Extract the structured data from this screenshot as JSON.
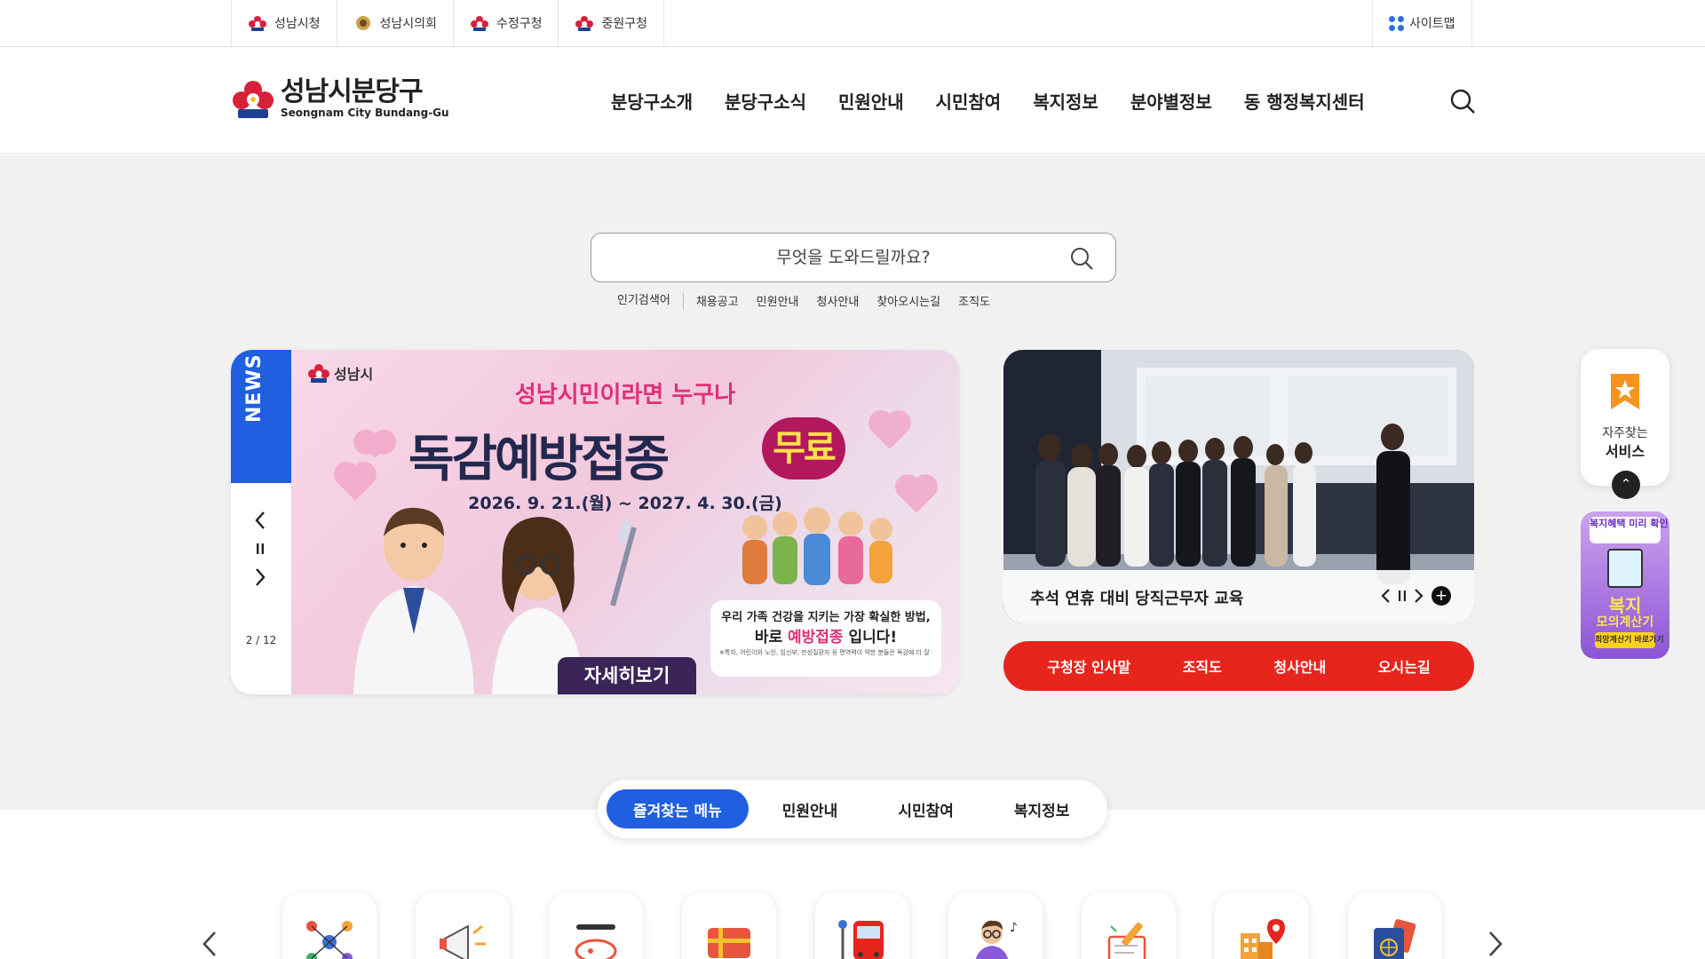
{
  "top_links": [
    {
      "label": "성남시청",
      "icon": "seongnam-emblem-icon"
    },
    {
      "label": "성남시의회",
      "icon": "council-emblem-icon"
    },
    {
      "label": "수정구청",
      "icon": "seongnam-emblem-icon"
    },
    {
      "label": "중원구청",
      "icon": "seongnam-emblem-icon"
    }
  ],
  "sitemap_label": "사이트맵",
  "logo": {
    "ko": "성남시분당구",
    "en": "Seongnam City Bundang-Gu"
  },
  "nav": [
    "분당구소개",
    "분당구소식",
    "민원안내",
    "시민참여",
    "복지정보",
    "분야별정보",
    "동 행정복지센터"
  ],
  "search": {
    "placeholder": "무엇을 도와드릴까요?"
  },
  "popular": {
    "label": "인기검색어",
    "keywords": [
      "채용공고",
      "민원안내",
      "청사안내",
      "찾아오시는길",
      "조직도"
    ]
  },
  "banner": {
    "tab": "NEWS",
    "pager": "2 / 12",
    "brand": "성남시",
    "subtitle": "성남시민이라면 누구나",
    "title": "독감예방접종",
    "badge": "무료",
    "date": "2026. 9. 21.(월) ~ 2027. 4. 30.(금)",
    "card_line1": "우리 가족 건강을 지키는 가장 확실한 방법,",
    "card_line2a": "바로 ",
    "card_line2b": "예방접종",
    "card_line2c": " 입니다!",
    "card_line3": "※특히, 어린이와 노인, 임신부, 만성질환자 등 면역력이 약한 분들은 독감에 더 잘 걸리고 합병증 발생률도 높아 더욱 주의가 필요합니다.",
    "more": "자세히보기"
  },
  "photo_news": {
    "caption": "추석 연휴 대비 당직근무자 교육"
  },
  "quick_links": [
    "구청장 인사말",
    "조직도",
    "청사안내",
    "오시는길"
  ],
  "quick_panel": {
    "line1": "자주찾는",
    "line2": "서비스"
  },
  "welfare_banner": {
    "top": "복지혜택 미리 확인!",
    "title": "복지",
    "subtitle": "모의계산기",
    "button": "희망계산기 바로가기"
  },
  "menu_tabs": [
    {
      "label": "즐겨찾는 메뉴",
      "active": true
    },
    {
      "label": "민원안내",
      "active": false
    },
    {
      "label": "시민참여",
      "active": false
    },
    {
      "label": "복지정보",
      "active": false
    }
  ],
  "menu_icons": [
    "network-icon",
    "megaphone-icon",
    "seongnam-welfare-icon",
    "gift-card-icon",
    "bus-icon",
    "teacher-icon",
    "writing-icon",
    "building-location-icon",
    "passport-icon"
  ],
  "colors": {
    "primary_blue": "#1f5fe0",
    "red": "#e8251d",
    "badge_magenta": "#b3175e"
  }
}
